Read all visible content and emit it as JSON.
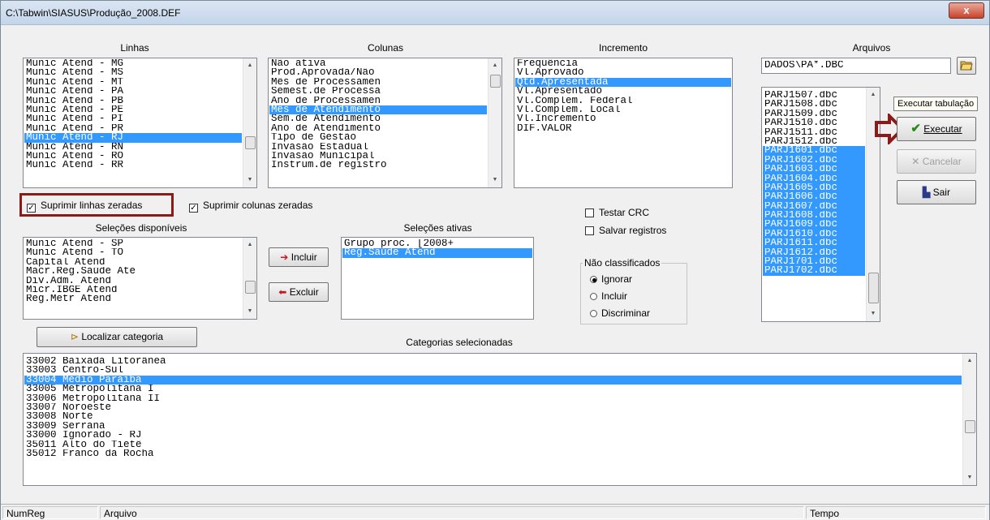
{
  "window": {
    "title": "C:\\Tabwin\\SIASUS\\Produção_2008.DEF",
    "close_glyph": "x"
  },
  "linhas": {
    "label": "Linhas",
    "items": [
      "Munic Atend - MG",
      "Munic Atend - MS",
      "Munic Atend - MT",
      "Munic Atend - PA",
      "Munic Atend - PB",
      "Munic Atend - PE",
      "Munic Atend - PI",
      "Munic Atend - PR",
      "Munic Atend - RJ",
      "Munic Atend - RN",
      "Munic Atend - RO",
      "Munic Atend - RR"
    ],
    "selected": "Munic Atend - RJ"
  },
  "colunas": {
    "label": "Colunas",
    "items": [
      "Não ativa",
      "Prod.Aprovada/Não",
      "Mês de Processamen",
      "Semest.de Processa",
      "Ano de Processamen",
      "Mês de Atendimento",
      "Sem.de Atendimento",
      "Ano de Atendimento",
      "Tipo de Gestão",
      "Invasão Estadual",
      "Invasão Municipal",
      "Instrum.de registro"
    ],
    "selected": "Mês de Atendimento"
  },
  "incremento": {
    "label": "Incremento",
    "items": [
      "Freqüência",
      "Vl.Aprovado",
      "Qtd.Apresentada",
      "Vl.Apresentado",
      "Vl.Complem. Federal",
      "Vl.Complem. Local",
      "Vl.Incremento",
      "DIF.VALOR"
    ],
    "selected": "Qtd.Apresentada"
  },
  "arquivos": {
    "label": "Arquivos",
    "path_value": "DADOS\\PA*.DBC",
    "items": [
      "PARJ1507.dbc",
      "PARJ1508.dbc",
      "PARJ1509.dbc",
      "PARJ1510.dbc",
      "PARJ1511.dbc",
      "PARJ1512.dbc",
      "PARJ1601.dbc",
      "PARJ1602.dbc",
      "PARJ1603.dbc",
      "PARJ1604.dbc",
      "PARJ1605.dbc",
      "PARJ1606.dbc",
      "PARJ1607.dbc",
      "PARJ1608.dbc",
      "PARJ1609.dbc",
      "PARJ1610.dbc",
      "PARJ1611.dbc",
      "PARJ1612.dbc",
      "PARJ1701.dbc",
      "PARJ1702.dbc"
    ],
    "selected_from_index": 6
  },
  "buttons": {
    "executar": "Executar",
    "cancelar": "Cancelar",
    "sair": "Sair",
    "incluir": "Incluir",
    "excluir": "Excluir",
    "localizar": "Localizar categoria",
    "tooltip": "Executar tabulação"
  },
  "options": {
    "suprimir_linhas": "Suprimir linhas zeradas",
    "suprimir_colunas": "Suprimir colunas zeradas",
    "testar_crc": "Testar CRC",
    "salvar_registros": "Salvar registros",
    "nao_classificados": "Não classificados",
    "ignorar": "Ignorar",
    "incluir": "Incluir",
    "discriminar": "Discriminar"
  },
  "selecoes_disponiveis": {
    "label": "Seleções disponíveis",
    "items": [
      "Munic Atend - SP",
      "Munic Atend - TO",
      "Capital Atend",
      "Macr.Reg.Saúde Ate",
      "Div.Adm. Atend",
      "Micr.IBGE Atend",
      "Reg.Metr Atend"
    ]
  },
  "selecoes_ativas": {
    "label": "Seleções ativas",
    "items": [
      "Grupo proc. [2008+",
      "Reg.Saúde Atend"
    ],
    "selected": "Reg.Saúde Atend"
  },
  "categorias": {
    "label": "Categorias selecionadas",
    "items": [
      "33002 Baixada Litorânea",
      "33003 Centro-Sul",
      "33004 Médio Paraíba",
      "33005 Metropolitana I",
      "33006 Metropolitana II",
      "33007 Noroeste",
      "33008 Norte",
      "33009 Serrana",
      "33000 Ignorado - RJ",
      "35011 Alto do Tietê",
      "35012 Franco da Rocha"
    ],
    "selected": "33004 Médio Paraíba"
  },
  "status": {
    "numreg": "NumReg",
    "arquivo": "Arquivo",
    "tempo": "Tempo"
  },
  "colors": {
    "selection": "#3399ff",
    "highlight_box": "#8b1a1a",
    "arrow": "#8b1a1a"
  }
}
